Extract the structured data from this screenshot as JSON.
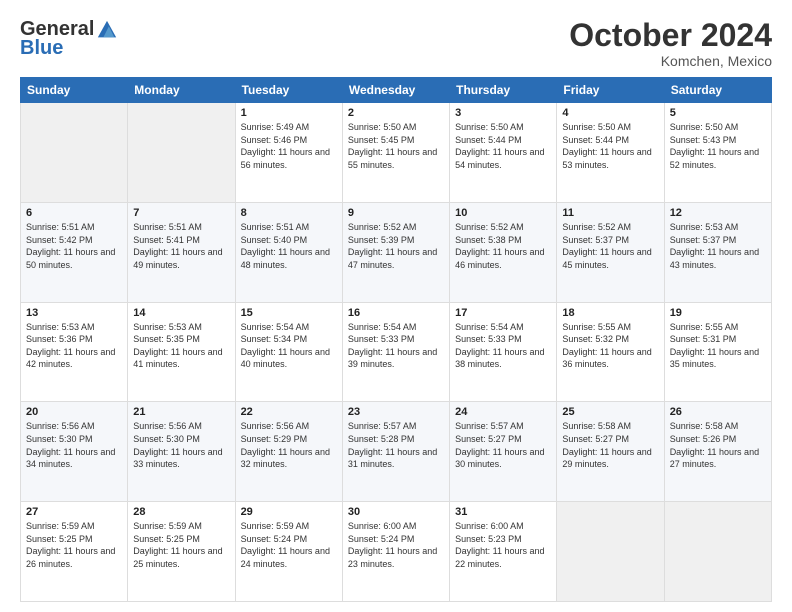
{
  "logo": {
    "general": "General",
    "blue": "Blue"
  },
  "header": {
    "month_year": "October 2024",
    "location": "Komchen, Mexico"
  },
  "days_of_week": [
    "Sunday",
    "Monday",
    "Tuesday",
    "Wednesday",
    "Thursday",
    "Friday",
    "Saturday"
  ],
  "weeks": [
    [
      {
        "day": "",
        "sunrise": "",
        "sunset": "",
        "daylight": ""
      },
      {
        "day": "",
        "sunrise": "",
        "sunset": "",
        "daylight": ""
      },
      {
        "day": "1",
        "sunrise": "Sunrise: 5:49 AM",
        "sunset": "Sunset: 5:46 PM",
        "daylight": "Daylight: 11 hours and 56 minutes."
      },
      {
        "day": "2",
        "sunrise": "Sunrise: 5:50 AM",
        "sunset": "Sunset: 5:45 PM",
        "daylight": "Daylight: 11 hours and 55 minutes."
      },
      {
        "day": "3",
        "sunrise": "Sunrise: 5:50 AM",
        "sunset": "Sunset: 5:44 PM",
        "daylight": "Daylight: 11 hours and 54 minutes."
      },
      {
        "day": "4",
        "sunrise": "Sunrise: 5:50 AM",
        "sunset": "Sunset: 5:44 PM",
        "daylight": "Daylight: 11 hours and 53 minutes."
      },
      {
        "day": "5",
        "sunrise": "Sunrise: 5:50 AM",
        "sunset": "Sunset: 5:43 PM",
        "daylight": "Daylight: 11 hours and 52 minutes."
      }
    ],
    [
      {
        "day": "6",
        "sunrise": "Sunrise: 5:51 AM",
        "sunset": "Sunset: 5:42 PM",
        "daylight": "Daylight: 11 hours and 50 minutes."
      },
      {
        "day": "7",
        "sunrise": "Sunrise: 5:51 AM",
        "sunset": "Sunset: 5:41 PM",
        "daylight": "Daylight: 11 hours and 49 minutes."
      },
      {
        "day": "8",
        "sunrise": "Sunrise: 5:51 AM",
        "sunset": "Sunset: 5:40 PM",
        "daylight": "Daylight: 11 hours and 48 minutes."
      },
      {
        "day": "9",
        "sunrise": "Sunrise: 5:52 AM",
        "sunset": "Sunset: 5:39 PM",
        "daylight": "Daylight: 11 hours and 47 minutes."
      },
      {
        "day": "10",
        "sunrise": "Sunrise: 5:52 AM",
        "sunset": "Sunset: 5:38 PM",
        "daylight": "Daylight: 11 hours and 46 minutes."
      },
      {
        "day": "11",
        "sunrise": "Sunrise: 5:52 AM",
        "sunset": "Sunset: 5:37 PM",
        "daylight": "Daylight: 11 hours and 45 minutes."
      },
      {
        "day": "12",
        "sunrise": "Sunrise: 5:53 AM",
        "sunset": "Sunset: 5:37 PM",
        "daylight": "Daylight: 11 hours and 43 minutes."
      }
    ],
    [
      {
        "day": "13",
        "sunrise": "Sunrise: 5:53 AM",
        "sunset": "Sunset: 5:36 PM",
        "daylight": "Daylight: 11 hours and 42 minutes."
      },
      {
        "day": "14",
        "sunrise": "Sunrise: 5:53 AM",
        "sunset": "Sunset: 5:35 PM",
        "daylight": "Daylight: 11 hours and 41 minutes."
      },
      {
        "day": "15",
        "sunrise": "Sunrise: 5:54 AM",
        "sunset": "Sunset: 5:34 PM",
        "daylight": "Daylight: 11 hours and 40 minutes."
      },
      {
        "day": "16",
        "sunrise": "Sunrise: 5:54 AM",
        "sunset": "Sunset: 5:33 PM",
        "daylight": "Daylight: 11 hours and 39 minutes."
      },
      {
        "day": "17",
        "sunrise": "Sunrise: 5:54 AM",
        "sunset": "Sunset: 5:33 PM",
        "daylight": "Daylight: 11 hours and 38 minutes."
      },
      {
        "day": "18",
        "sunrise": "Sunrise: 5:55 AM",
        "sunset": "Sunset: 5:32 PM",
        "daylight": "Daylight: 11 hours and 36 minutes."
      },
      {
        "day": "19",
        "sunrise": "Sunrise: 5:55 AM",
        "sunset": "Sunset: 5:31 PM",
        "daylight": "Daylight: 11 hours and 35 minutes."
      }
    ],
    [
      {
        "day": "20",
        "sunrise": "Sunrise: 5:56 AM",
        "sunset": "Sunset: 5:30 PM",
        "daylight": "Daylight: 11 hours and 34 minutes."
      },
      {
        "day": "21",
        "sunrise": "Sunrise: 5:56 AM",
        "sunset": "Sunset: 5:30 PM",
        "daylight": "Daylight: 11 hours and 33 minutes."
      },
      {
        "day": "22",
        "sunrise": "Sunrise: 5:56 AM",
        "sunset": "Sunset: 5:29 PM",
        "daylight": "Daylight: 11 hours and 32 minutes."
      },
      {
        "day": "23",
        "sunrise": "Sunrise: 5:57 AM",
        "sunset": "Sunset: 5:28 PM",
        "daylight": "Daylight: 11 hours and 31 minutes."
      },
      {
        "day": "24",
        "sunrise": "Sunrise: 5:57 AM",
        "sunset": "Sunset: 5:27 PM",
        "daylight": "Daylight: 11 hours and 30 minutes."
      },
      {
        "day": "25",
        "sunrise": "Sunrise: 5:58 AM",
        "sunset": "Sunset: 5:27 PM",
        "daylight": "Daylight: 11 hours and 29 minutes."
      },
      {
        "day": "26",
        "sunrise": "Sunrise: 5:58 AM",
        "sunset": "Sunset: 5:26 PM",
        "daylight": "Daylight: 11 hours and 27 minutes."
      }
    ],
    [
      {
        "day": "27",
        "sunrise": "Sunrise: 5:59 AM",
        "sunset": "Sunset: 5:25 PM",
        "daylight": "Daylight: 11 hours and 26 minutes."
      },
      {
        "day": "28",
        "sunrise": "Sunrise: 5:59 AM",
        "sunset": "Sunset: 5:25 PM",
        "daylight": "Daylight: 11 hours and 25 minutes."
      },
      {
        "day": "29",
        "sunrise": "Sunrise: 5:59 AM",
        "sunset": "Sunset: 5:24 PM",
        "daylight": "Daylight: 11 hours and 24 minutes."
      },
      {
        "day": "30",
        "sunrise": "Sunrise: 6:00 AM",
        "sunset": "Sunset: 5:24 PM",
        "daylight": "Daylight: 11 hours and 23 minutes."
      },
      {
        "day": "31",
        "sunrise": "Sunrise: 6:00 AM",
        "sunset": "Sunset: 5:23 PM",
        "daylight": "Daylight: 11 hours and 22 minutes."
      },
      {
        "day": "",
        "sunrise": "",
        "sunset": "",
        "daylight": ""
      },
      {
        "day": "",
        "sunrise": "",
        "sunset": "",
        "daylight": ""
      }
    ]
  ]
}
